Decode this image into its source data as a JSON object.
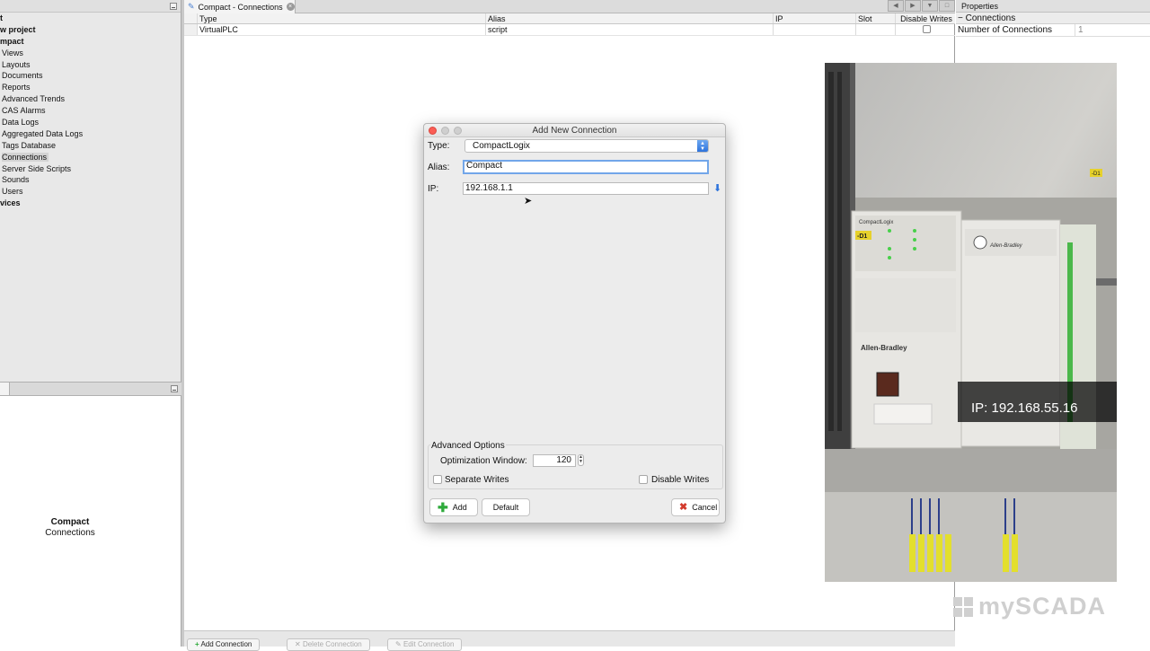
{
  "left_panel": {
    "tree": [
      {
        "label": "t",
        "bold": true,
        "indent": false
      },
      {
        "label": "w project",
        "bold": true,
        "indent": false
      },
      {
        "label": "mpact",
        "bold": true,
        "indent": false
      },
      {
        "label": "Views",
        "bold": false,
        "indent": true
      },
      {
        "label": "Layouts",
        "bold": false,
        "indent": true
      },
      {
        "label": "Documents",
        "bold": false,
        "indent": true
      },
      {
        "label": "Reports",
        "bold": false,
        "indent": true
      },
      {
        "label": "Advanced Trends",
        "bold": false,
        "indent": true
      },
      {
        "label": "CAS Alarms",
        "bold": false,
        "indent": true
      },
      {
        "label": "Data Logs",
        "bold": false,
        "indent": true
      },
      {
        "label": "Aggregated Data Logs",
        "bold": false,
        "indent": true
      },
      {
        "label": "Tags Database",
        "bold": false,
        "indent": true
      },
      {
        "label": "Connections",
        "bold": false,
        "indent": true,
        "selected": true
      },
      {
        "label": "Server Side Scripts",
        "bold": false,
        "indent": true
      },
      {
        "label": "Sounds",
        "bold": false,
        "indent": true
      },
      {
        "label": "Users",
        "bold": false,
        "indent": true
      },
      {
        "label": "vices",
        "bold": true,
        "indent": false
      }
    ],
    "bottom_title": "Compact",
    "bottom_subtitle": "Connections"
  },
  "editor": {
    "tab_label": "Compact - Connections",
    "columns": [
      "Type",
      "Alias",
      "IP",
      "Slot",
      "Disable Writes"
    ],
    "rows": [
      {
        "type": "VirtualPLC",
        "alias": "script",
        "ip": "",
        "slot": "",
        "disable_writes": false
      }
    ],
    "bottom_buttons": {
      "add": "Add Connection",
      "delete": "Delete Connection",
      "edit": "Edit Connection"
    }
  },
  "properties": {
    "title": "Properties",
    "section": "Connections",
    "rows": [
      {
        "key": "Number of Connections",
        "value": "1"
      }
    ]
  },
  "dialog": {
    "title": "Add New Connection",
    "type_label": "Type:",
    "type_value": "CompactLogix",
    "alias_label": "Alias:",
    "alias_value": "Compact",
    "ip_label": "IP:",
    "ip_value": "192.168.1.1",
    "advanced_title": "Advanced Options",
    "optimization_label": "Optimization Window:",
    "optimization_value": "120",
    "separate_writes_label": "Separate Writes",
    "disable_writes_label": "Disable Writes",
    "add_button": "Add",
    "default_button": "Default",
    "cancel_button": "Cancel"
  },
  "photo": {
    "ip_overlay": "IP: 192.168.55.16",
    "compactlogix_label": "CompactLogix",
    "allen_bradley_label": "Allen-Bradley",
    "tag_d1": "-D1",
    "tag_d1_small": "-D1"
  },
  "watermark": "mySCADA",
  "colors": {
    "accent_blue": "#2d73dc",
    "add_green": "#2eaa3b",
    "cancel_red": "#d33a2c",
    "traffic_red": "#fb5d55"
  }
}
